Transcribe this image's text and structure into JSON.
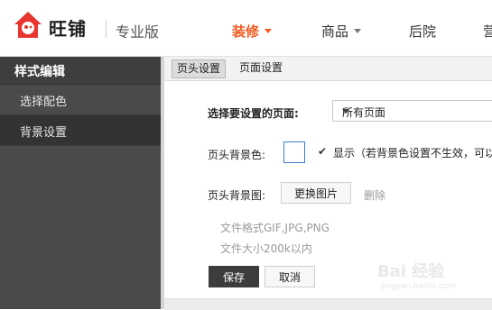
{
  "header": {
    "brand": "旺铺",
    "edition": "专业版",
    "nav": [
      {
        "label": "装修",
        "active": true,
        "has_caret": true
      },
      {
        "label": "商品",
        "active": false,
        "has_caret": true
      },
      {
        "label": "后院",
        "active": false,
        "has_caret": false
      },
      {
        "label": "营",
        "active": false,
        "has_caret": false
      }
    ]
  },
  "sidebar": {
    "title": "样式编辑",
    "items": [
      {
        "label": "选择配色",
        "selected": false
      },
      {
        "label": "背景设置",
        "selected": true
      }
    ]
  },
  "tabs": [
    {
      "label": "页头设置",
      "selected": true
    },
    {
      "label": "页面设置",
      "selected": false
    }
  ],
  "form": {
    "page_label": "选择要设置的页面:",
    "page_value": "所有页面",
    "bgcolor_label": "页头背景色:",
    "display_checkbox_checked": true,
    "display_hint": "显示（若背景色设置不生效，可以",
    "bgimage_label": "页头背景图:",
    "replace_button": "更换图片",
    "delete_link": "删除",
    "format_note": "文件格式GIF,JPG,PNG",
    "size_note": "文件大小200k以内",
    "save_button": "保存",
    "cancel_button": "取消"
  },
  "watermark": {
    "text": "Bai 经验",
    "sub": "jingyan.baidu.com"
  },
  "colors": {
    "accent": "#f05b1f",
    "sidebar_bg": "#4a4a4a",
    "sidebar_selected": "#333333",
    "logo_red": "#e8352d"
  },
  "icons": {
    "logo": "house-logo-icon",
    "caret": "caret-down-icon",
    "check": "checkmark-icon"
  }
}
